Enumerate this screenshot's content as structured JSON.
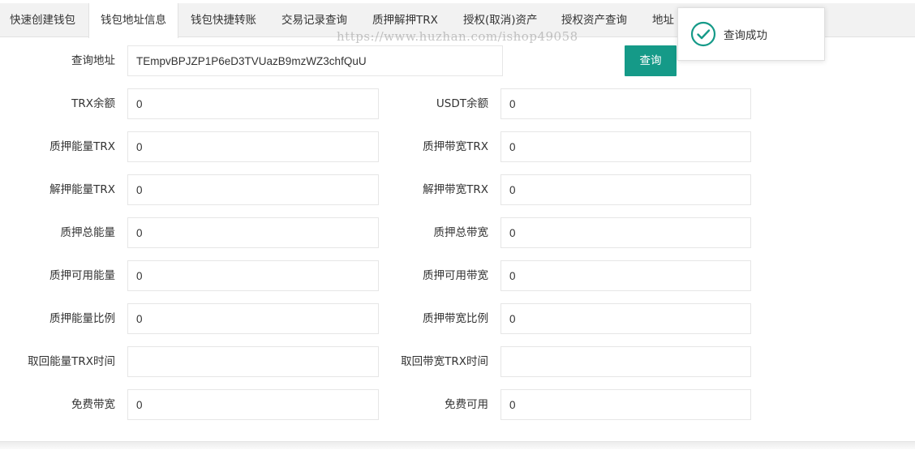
{
  "tabs": [
    {
      "label": "快速创建钱包"
    },
    {
      "label": "钱包地址信息"
    },
    {
      "label": "钱包快捷转账"
    },
    {
      "label": "交易记录查询"
    },
    {
      "label": "质押解押TRX"
    },
    {
      "label": "授权(取消)资产"
    },
    {
      "label": "授权资产查询"
    },
    {
      "label": "地址"
    }
  ],
  "watermark": "https://www.huzhan.com/ishop49058",
  "query": {
    "label": "查询地址",
    "value": "TEmpvBPJZP1P6eD3TVUazB9mzWZ3chfQuU",
    "button": "查询"
  },
  "fields": {
    "trx_balance": {
      "label": "TRX余额",
      "value": "0"
    },
    "usdt_balance": {
      "label": "USDT余额",
      "value": "0"
    },
    "stake_energy_trx": {
      "label": "质押能量TRX",
      "value": "0"
    },
    "stake_bandwidth_trx": {
      "label": "质押带宽TRX",
      "value": "0"
    },
    "unstake_energy_trx": {
      "label": "解押能量TRX",
      "value": "0"
    },
    "unstake_bandwidth_trx": {
      "label": "解押带宽TRX",
      "value": "0"
    },
    "stake_total_energy": {
      "label": "质押总能量",
      "value": "0"
    },
    "stake_total_bandwidth": {
      "label": "质押总带宽",
      "value": "0"
    },
    "stake_available_energy": {
      "label": "质押可用能量",
      "value": "0"
    },
    "stake_available_bandwidth": {
      "label": "质押可用带宽",
      "value": "0"
    },
    "stake_energy_ratio": {
      "label": "质押能量比例",
      "value": "0"
    },
    "stake_bandwidth_ratio": {
      "label": "质押带宽比例",
      "value": "0"
    },
    "reclaim_energy_time": {
      "label": "取回能量TRX时间",
      "value": ""
    },
    "reclaim_bandwidth_time": {
      "label": "取回带宽TRX时间",
      "value": ""
    },
    "free_bandwidth": {
      "label": "免费带宽",
      "value": "0"
    },
    "free_available": {
      "label": "免费可用",
      "value": "0"
    }
  },
  "toast": {
    "message": "查询成功",
    "icon": "check-circle-icon",
    "color": "#159a88"
  },
  "colors": {
    "primary_button": "#159a88",
    "tab_bar": "#f2f2f2"
  }
}
